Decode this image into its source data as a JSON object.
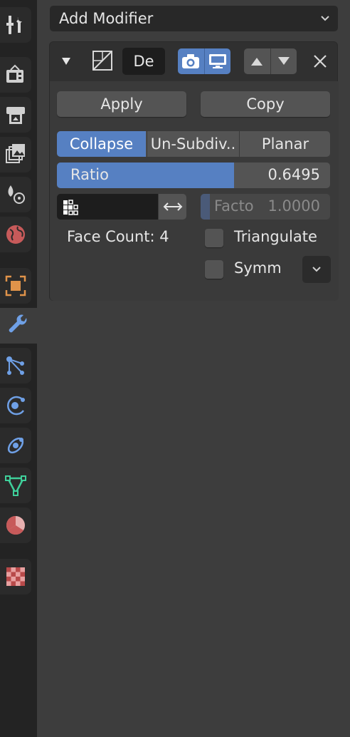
{
  "tabs": [
    {
      "name": "tool-tab",
      "icon": "tool-icon"
    },
    {
      "name": "render-tab",
      "icon": "render-camera-icon"
    },
    {
      "name": "output-tab",
      "icon": "printer-icon"
    },
    {
      "name": "view-layer-tab",
      "icon": "image-stack-icon"
    },
    {
      "name": "scene-tab",
      "icon": "scene-icon"
    },
    {
      "name": "world-tab",
      "icon": "world-icon"
    },
    {
      "name": "object-tab",
      "icon": "object-square-icon"
    },
    {
      "name": "modifier-tab",
      "icon": "wrench-icon",
      "active": true
    },
    {
      "name": "particles-tab",
      "icon": "particles-icon"
    },
    {
      "name": "physics-tab",
      "icon": "physics-icon"
    },
    {
      "name": "constraints-tab",
      "icon": "constraint-icon"
    },
    {
      "name": "data-tab",
      "icon": "mesh-triangle-icon"
    },
    {
      "name": "material-tab",
      "icon": "material-sphere-icon"
    },
    {
      "name": "texture-tab",
      "icon": "checker-texture-icon"
    }
  ],
  "add_modifier": {
    "label": "Add Modifier"
  },
  "modifier": {
    "name_value": "De",
    "apply_label": "Apply",
    "copy_label": "Copy",
    "modes": [
      "Collapse",
      "Un-Subdiv..",
      "Planar"
    ],
    "active_mode": "Collapse",
    "ratio_label": "Ratio",
    "ratio_value": "0.6495",
    "ratio_fraction": 0.6495,
    "factor_label": "Facto",
    "factor_value": "1.0000",
    "face_count": "Face Count: 4",
    "triangulate_label": "Triangulate",
    "symmetry_label": "Symm"
  },
  "colors": {
    "accent": "#5680c2",
    "panel": "#303030",
    "background": "#3d3d3d",
    "button": "#545454"
  }
}
